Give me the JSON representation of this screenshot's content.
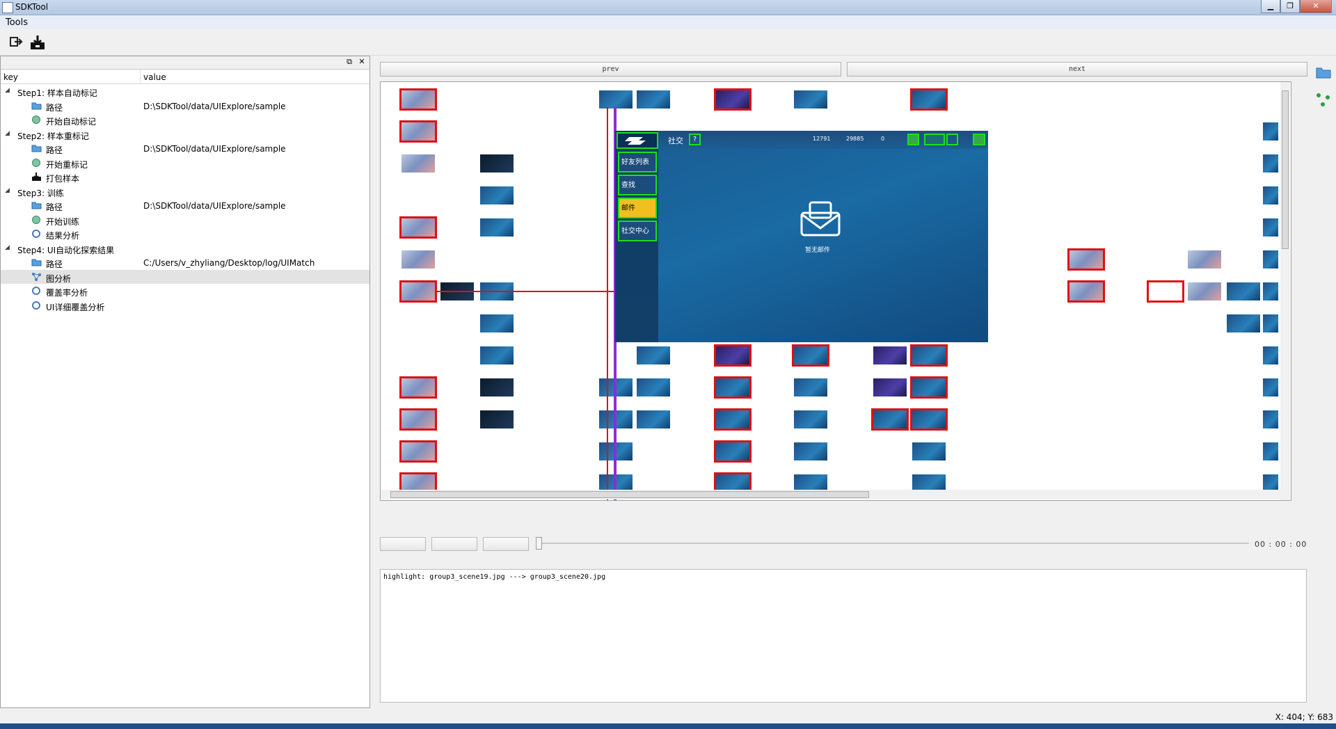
{
  "window": {
    "title": "SDKTool"
  },
  "menu": {
    "tools": "Tools"
  },
  "dock": {
    "col_key": "key",
    "col_value": "value",
    "rows": [
      {
        "label": "Step1: 样本自动标记",
        "value": ""
      },
      {
        "label": "路径",
        "value": "D:\\SDKTool/data/UIExplore/sample"
      },
      {
        "label": "开始自动标记",
        "value": ""
      },
      {
        "label": "Step2: 样本重标记",
        "value": ""
      },
      {
        "label": "路径",
        "value": "D:\\SDKTool/data/UIExplore/sample"
      },
      {
        "label": "开始重标记",
        "value": ""
      },
      {
        "label": "打包样本",
        "value": ""
      },
      {
        "label": "Step3: 训练",
        "value": ""
      },
      {
        "label": "路径",
        "value": "D:\\SDKTool/data/UIExplore/sample"
      },
      {
        "label": "开始训练",
        "value": ""
      },
      {
        "label": "结果分析",
        "value": ""
      },
      {
        "label": "Step4: UI自动化探索结果",
        "value": ""
      },
      {
        "label": "路径",
        "value": "C:/Users/v_zhyliang/Desktop/log/UIMatch"
      },
      {
        "label": "图分析",
        "value": ""
      },
      {
        "label": "覆盖率分析",
        "value": ""
      },
      {
        "label": "UI详细覆盖分析",
        "value": ""
      }
    ]
  },
  "nav": {
    "prev": "prev",
    "next": "next"
  },
  "overlay": {
    "header_label": "社交",
    "help": "?",
    "coins": "12791",
    "gems": "29885",
    "diamonds": "0",
    "menu": [
      "好友列表",
      "查找",
      "邮件",
      "社交中心"
    ],
    "empty_text": "暂无邮件"
  },
  "playback": {
    "time": "00 : 00 : 00"
  },
  "console": {
    "text": "highlight: group3_scene19.jpg ---> group3_scene20.jpg"
  },
  "status": {
    "coords": "X: 404; Y: 683"
  }
}
